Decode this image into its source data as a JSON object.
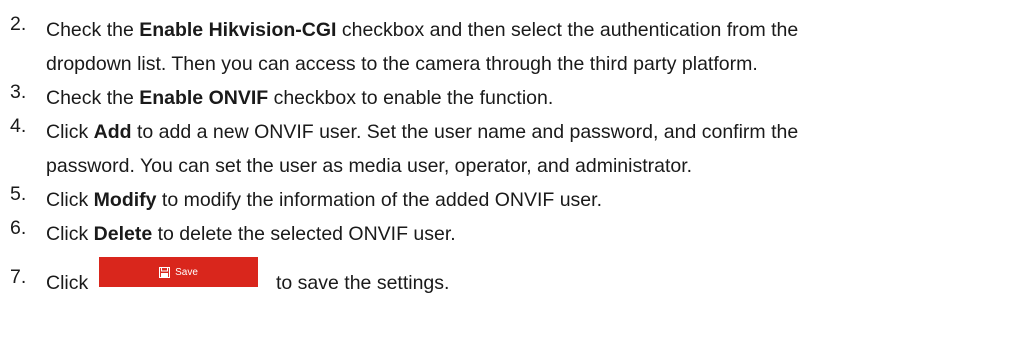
{
  "steps": [
    {
      "number": "2.",
      "lines": [
        [
          "Check the ",
          "Enable Hikvision-CGI",
          " checkbox and then select the authentication from the"
        ],
        [
          "dropdown list. Then you can access to the camera through the third party platform."
        ]
      ]
    },
    {
      "number": "3.",
      "lines": [
        [
          "Check the ",
          "Enable ONVIF",
          " checkbox to enable the function."
        ]
      ]
    },
    {
      "number": "4.",
      "lines": [
        [
          "Click ",
          "Add",
          " to add a new ONVIF user. Set the user name and password, and confirm the"
        ],
        [
          "password. You can set the user as media user, operator, and administrator."
        ]
      ]
    },
    {
      "number": "5.",
      "lines": [
        [
          "Click ",
          "Modify",
          " to modify the information of the added ONVIF user."
        ]
      ]
    },
    {
      "number": "6.",
      "lines": [
        [
          "Click ",
          "Delete",
          " to delete the selected ONVIF user."
        ]
      ]
    },
    {
      "number": "7.",
      "before_button": "Click",
      "button_label": "Save",
      "button_icon": "floppy-disk-icon",
      "after_button": "to save the settings."
    }
  ],
  "colors": {
    "text": "#1a1a1a",
    "save_button_bg": "#d9261c",
    "save_button_text": "#ffffff"
  }
}
